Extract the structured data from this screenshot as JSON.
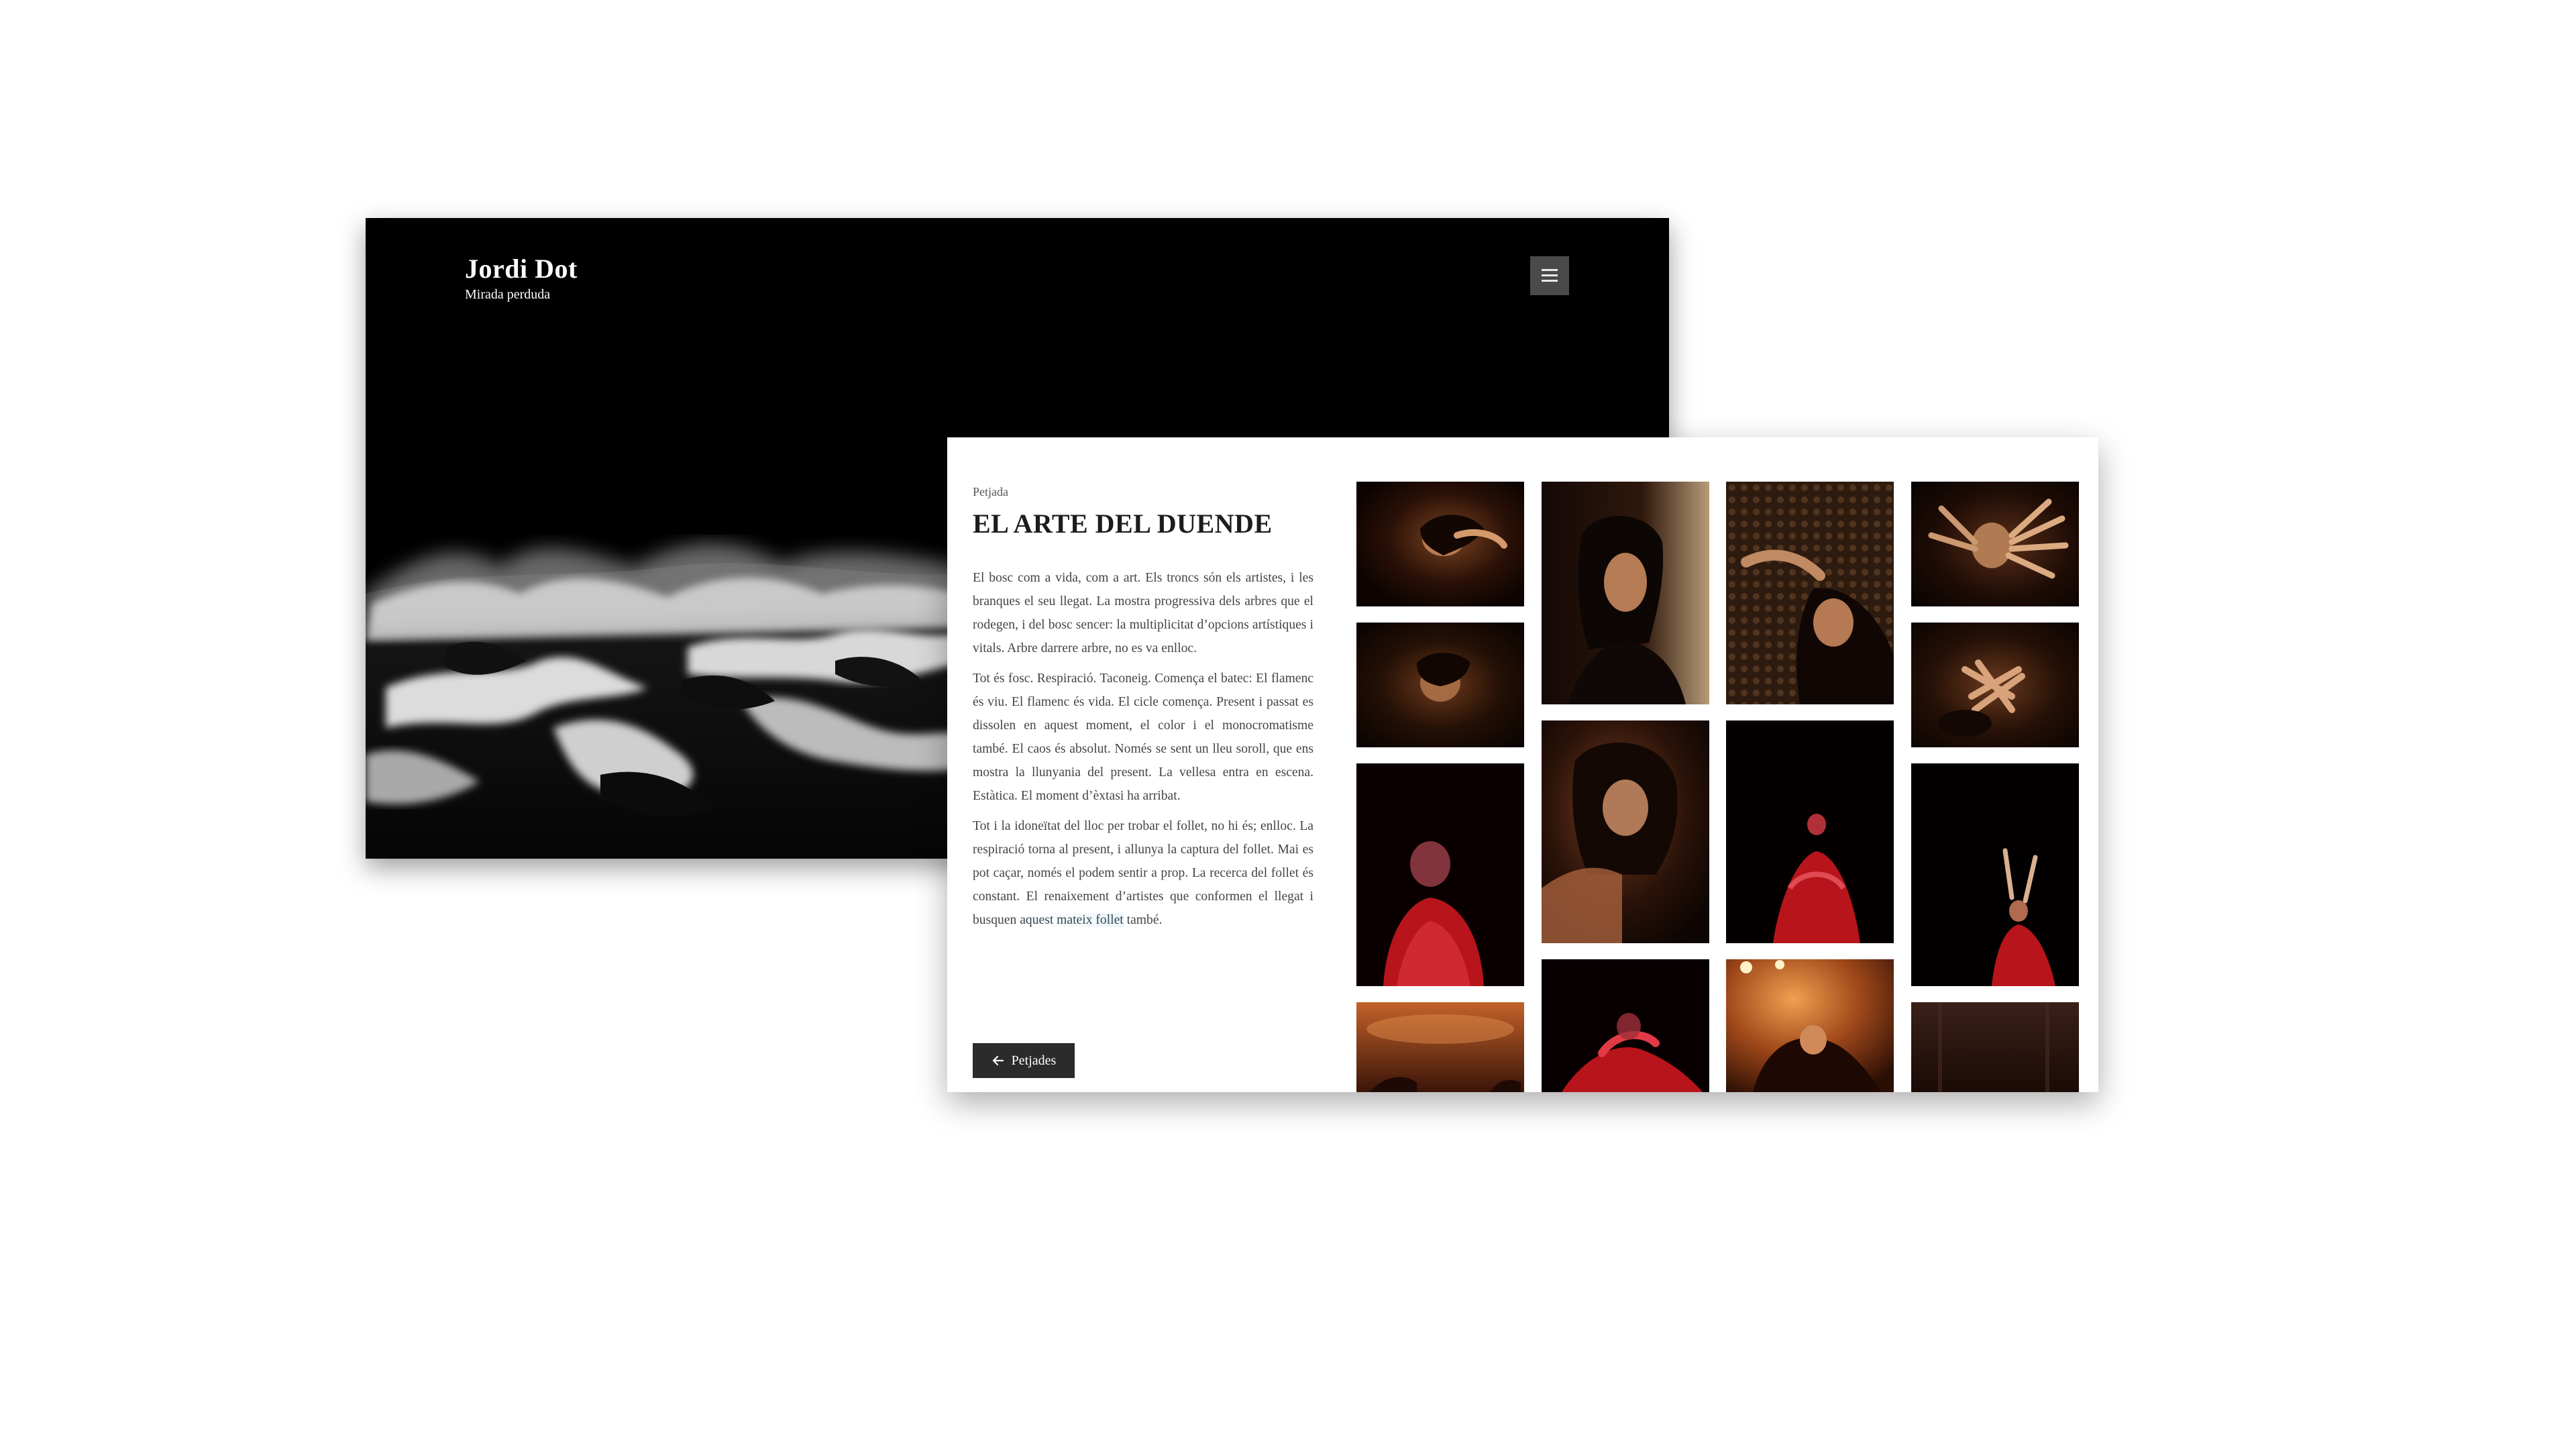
{
  "home": {
    "site_title": "Jordi Dot",
    "site_tagline": "Mirada perduda",
    "menu_icon": "hamburger-icon",
    "hero_image": "black-and-white-sea-waves"
  },
  "project": {
    "category": "Petjada",
    "title": "EL ARTE DEL DUENDE",
    "paragraphs": [
      "El bosc com a vida, com a art. Els troncs són els artistes, i les branques el seu llegat. La mostra progressiva dels arbres que el rodegen, i del bosc sencer: la multiplicitat d’opcions artístiques i vitals. Arbre darrere arbre, no es va enlloc.",
      "Tot és fosc. Respiració. Taconeig. Comença el batec: El flamenc és viu. El flamenc és vida. El cicle comença. Present i passat es dissolen en aquest moment, el color i el monocromatisme també. El caos és absolut. Només se sent un lleu soroll, que ens mostra la llunyania del present. La vellesa entra en escena. Estàtica. El moment d’èxtasi ha arribat.",
      "Tot i la idoneïtat del lloc per trobar el follet, no hi és; enlloc. La respiració torna al present, i allunya la captura del follet. Mai es pot caçar, només el podem sentir a prop. La recerca del follet és constant. El renaixement d’artistes que conformen el llegat i busquen"
    ],
    "paragraph3_highlight": "aquest mateix follet",
    "paragraph3_end": "també.",
    "back_button_label": "Petjades",
    "back_icon": "arrow-left-icon"
  },
  "gallery": {
    "thumbnails": [
      {
        "subject": "man-with-hand-over-face"
      },
      {
        "subject": "man-looking-down-in-shadow"
      },
      {
        "subject": "dancer-in-red-shawl"
      },
      {
        "subject": "stage-with-warm-light"
      },
      {
        "subject": "long-haired-man-profile"
      },
      {
        "subject": "man-with-hair-over-face"
      },
      {
        "subject": "red-lit-dancer-motion"
      },
      {
        "subject": "man-in-front-of-tapestry"
      },
      {
        "subject": "dancer-with-castanets"
      },
      {
        "subject": "performance-under-lamps"
      },
      {
        "subject": "man-with-spread-fingers"
      },
      {
        "subject": "hands-clasped-gesture"
      },
      {
        "subject": "dancer-raising-arms-on-dark-stage"
      },
      {
        "subject": "dark-interior"
      }
    ]
  },
  "colors": {
    "page_bg": "#ffffff",
    "home_bg": "#000000",
    "menu_button_bg": "#4a4a4a",
    "title_text": "#1c1c1c",
    "body_text": "#444444",
    "back_button_bg": "#2b2b2b",
    "photo_warm_dark": "#2a1006",
    "photo_red": "#b8141c"
  }
}
